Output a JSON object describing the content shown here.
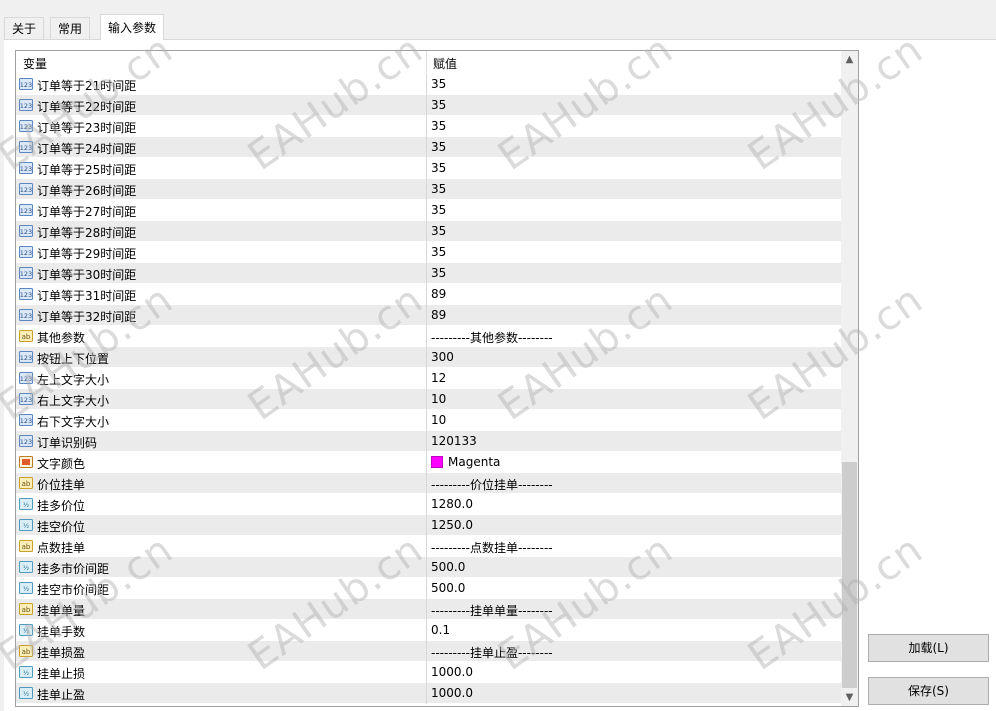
{
  "tabs": [
    "关于",
    "常用",
    "输入参数"
  ],
  "table": {
    "header_var": "变量",
    "header_val": "赋值",
    "rows": [
      {
        "icon": "int",
        "name": "订单等于21时间距",
        "value": "35"
      },
      {
        "icon": "int",
        "name": "订单等于22时间距",
        "value": "35"
      },
      {
        "icon": "int",
        "name": "订单等于23时间距",
        "value": "35"
      },
      {
        "icon": "int",
        "name": "订单等于24时间距",
        "value": "35"
      },
      {
        "icon": "int",
        "name": "订单等于25时间距",
        "value": "35"
      },
      {
        "icon": "int",
        "name": "订单等于26时间距",
        "value": "35"
      },
      {
        "icon": "int",
        "name": "订单等于27时间距",
        "value": "35"
      },
      {
        "icon": "int",
        "name": "订单等于28时间距",
        "value": "35"
      },
      {
        "icon": "int",
        "name": "订单等于29时间距",
        "value": "35"
      },
      {
        "icon": "int",
        "name": "订单等于30时间距",
        "value": "35"
      },
      {
        "icon": "int",
        "name": "订单等于31时间距",
        "value": "89"
      },
      {
        "icon": "int",
        "name": "订单等于32时间距",
        "value": "89"
      },
      {
        "icon": "str",
        "name": "其他参数",
        "value": "---------其他参数--------"
      },
      {
        "icon": "int",
        "name": "按钮上下位置",
        "value": "300"
      },
      {
        "icon": "int",
        "name": "左上文字大小",
        "value": "12"
      },
      {
        "icon": "int",
        "name": "右上文字大小",
        "value": "10"
      },
      {
        "icon": "int",
        "name": "右下文字大小",
        "value": "10"
      },
      {
        "icon": "int",
        "name": "订单识别码",
        "value": "120133"
      },
      {
        "icon": "color",
        "name": "文字颜色",
        "value": "Magenta",
        "swatch": "#ff00ff"
      },
      {
        "icon": "str",
        "name": "价位挂单",
        "value": "---------价位挂单--------"
      },
      {
        "icon": "dbl",
        "name": "挂多价位",
        "value": "1280.0"
      },
      {
        "icon": "dbl",
        "name": "挂空价位",
        "value": "1250.0"
      },
      {
        "icon": "str",
        "name": "点数挂单",
        "value": "---------点数挂单--------"
      },
      {
        "icon": "dbl",
        "name": "挂多市价间距",
        "value": "500.0"
      },
      {
        "icon": "dbl",
        "name": "挂空市价间距",
        "value": "500.0"
      },
      {
        "icon": "str",
        "name": "挂单单量",
        "value": "---------挂单单量--------"
      },
      {
        "icon": "dbl",
        "name": "挂单手数",
        "value": "0.1"
      },
      {
        "icon": "str",
        "name": "挂单损盈",
        "value": "---------挂单止盈--------"
      },
      {
        "icon": "dbl",
        "name": "挂单止损",
        "value": "1000.0"
      },
      {
        "icon": "dbl",
        "name": "挂单止盈",
        "value": "1000.0"
      }
    ]
  },
  "buttons": {
    "load": "加载(L)",
    "save": "保存(S)"
  },
  "scroll": {
    "up": "▲",
    "down": "▼"
  },
  "watermark": "EAHub.cn"
}
